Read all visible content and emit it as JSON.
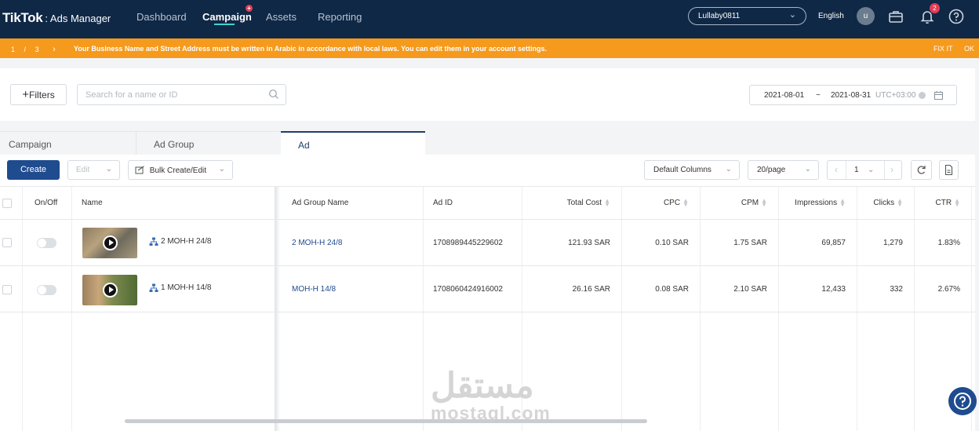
{
  "app": {
    "logo": "TikTok",
    "logo_suffix": ": Ads Manager"
  },
  "nav": {
    "items": [
      {
        "label": "Dashboard"
      },
      {
        "label": "Campaign"
      },
      {
        "label": "Assets"
      },
      {
        "label": "Reporting"
      }
    ],
    "active": "Campaign",
    "campaign_plus": "+"
  },
  "account": {
    "name": "Lullaby0811"
  },
  "language": "English",
  "user": {
    "initial": "u"
  },
  "notifications": {
    "count": "2"
  },
  "notice": {
    "pager_current": "1",
    "pager_sep": "/",
    "pager_total": "3",
    "pager_next": "›",
    "message": "Your Business Name and Street Address must be written in Arabic in accordance with local laws. You can edit them in your account settings.",
    "fix_label": "FIX IT",
    "ok_label": "OK",
    "color": "#f59a1d"
  },
  "filters": {
    "button_label": "Filters",
    "search_placeholder": "Search for a name or ID",
    "date_start": "2021-08-01",
    "date_sep": "~",
    "date_end": "2021-08-31",
    "timezone": "UTC+03:00"
  },
  "tabs": [
    {
      "label": "Campaign"
    },
    {
      "label": "Ad Group"
    },
    {
      "label": "Ad"
    }
  ],
  "toolbar": {
    "create_label": "Create",
    "edit_label": "Edit",
    "bulk_label": "Bulk Create/Edit",
    "columns_label": "Default Columns",
    "page_size_label": "20/page",
    "current_page": "1"
  },
  "table": {
    "headers": {
      "onoff": "On/Off",
      "name": "Name",
      "adgroup": "Ad Group Name",
      "adid": "Ad ID",
      "cost": "Total Cost",
      "cpc": "CPC",
      "cpm": "CPM",
      "impressions": "Impressions",
      "clicks": "Clicks",
      "ctr": "CTR"
    },
    "rows": [
      {
        "name": "2 MOH-H 24/8",
        "adgroup": "2 MOH-H 24/8",
        "adid": "1708989445229602",
        "cost": "121.93 SAR",
        "cpc": "0.10 SAR",
        "cpm": "1.75 SAR",
        "impressions": "69,857",
        "clicks": "1,279",
        "ctr": "1.83%"
      },
      {
        "name": "1 MOH-H 14/8",
        "adgroup": "MOH-H 14/8",
        "adid": "1708060424916002",
        "cost": "26.16 SAR",
        "cpc": "0.08 SAR",
        "cpm": "2.10 SAR",
        "impressions": "12,433",
        "clicks": "332",
        "ctr": "2.67%"
      }
    ]
  },
  "watermark": {
    "arabic": "مستقل",
    "latin": "mostaql.com"
  },
  "colors": {
    "nav_bg": "#0f2846",
    "primary": "#1f4b8f",
    "accent": "#3fd4cf",
    "badge": "#e23d58"
  }
}
